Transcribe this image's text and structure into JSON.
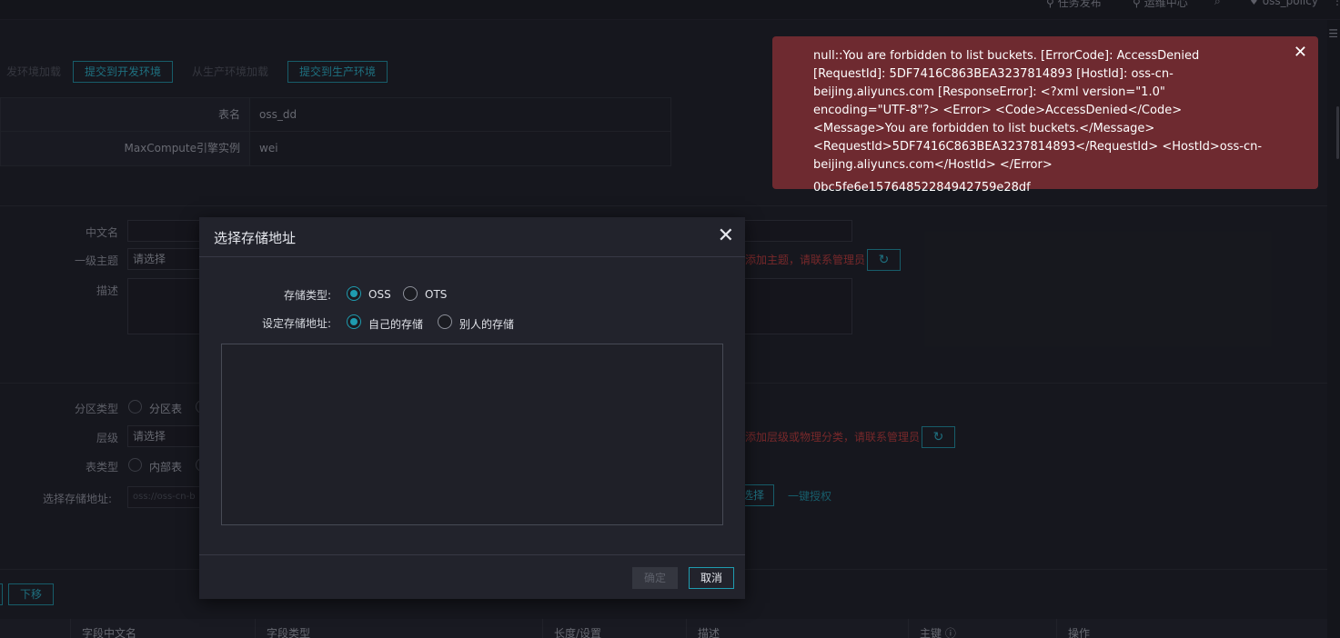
{
  "topbar": {
    "items": [
      {
        "icon": "wrench-icon",
        "label": "任务发布"
      },
      {
        "icon": "wrench-icon",
        "label": "运维中心"
      },
      {
        "icon": "search-icon",
        "label": ""
      },
      {
        "icon": "user-icon",
        "label": "oss_policy"
      }
    ]
  },
  "actions": {
    "load_dev": "发环境加载",
    "submit_dev": "提交到开发环境",
    "load_prod": "从生产环境加载",
    "submit_prod": "提交到生产环境"
  },
  "info": {
    "rows": [
      {
        "key": "表名",
        "value": "oss_dd"
      },
      {
        "key": "MaxCompute引擎实例",
        "value": "wei"
      }
    ]
  },
  "form": {
    "chinese_name_label": "中文名",
    "topic_label": "一级主题",
    "topic_placeholder": "请选择",
    "topic_error": "添加主题，请联系管理员",
    "desc_label": "描述",
    "partition_label": "分区类型",
    "partition_option": "分区表",
    "level_label": "层级",
    "level_placeholder": "请选择",
    "level_error": "添加层级或物理分类，请联系管理员",
    "table_type_label": "表类型",
    "table_type_option": "内部表",
    "storage_label": "选择存储地址:",
    "storage_placeholder": "oss://oss-cn-b",
    "select_btn": "选择",
    "grant_link": "一键授权"
  },
  "move": {
    "down": "下移"
  },
  "columns": [
    "字段中文名",
    "字段类型",
    "长度/设置",
    "描述",
    "主键",
    "操作"
  ],
  "modal": {
    "title": "选择存储地址",
    "storage_type_label": "存储类型:",
    "storage_type_options": [
      "OSS",
      "OTS"
    ],
    "storage_type_selected": "OSS",
    "address_label": "设定存储地址:",
    "address_options": [
      "自己的存储",
      "别人的存储"
    ],
    "address_selected": "自己的存储",
    "confirm": "确定",
    "cancel": "取消"
  },
  "toast": {
    "message": "null::You are forbidden to list buckets. [ErrorCode]: AccessDenied [RequestId]: 5DF7416C863BEA3237814893 [HostId]: oss-cn-beijing.aliyuncs.com [ResponseError]: <?xml version=\"1.0\" encoding=\"UTF-8\"?> <Error> <Code>AccessDenied</Code> <Message>You are forbidden to list buckets.</Message> <RequestId>5DF7416C863BEA3237814893</RequestId> <HostId>oss-cn-beijing.aliyuncs.com</HostId> </Error>",
    "trace_id": "0bc5fe6e15764852284942759e28df"
  }
}
